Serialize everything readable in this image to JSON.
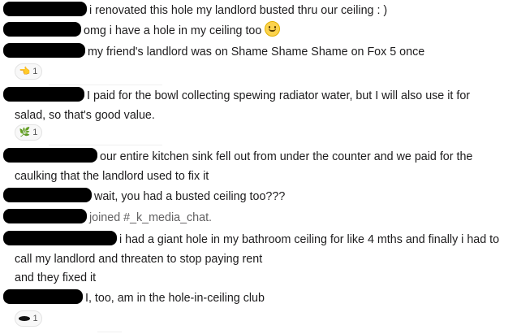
{
  "messages": [
    {
      "text": "i renovated this hole my landlord busted thru our ceiling : )"
    },
    {
      "text": "omg i have a hole in my ceiling too",
      "emoji": "smiley-face"
    },
    {
      "text": "my friend's landlord was on Shame Shame Shame on Fox 5 once"
    },
    {
      "line1": "I paid for the bowl collecting spewing radiator water, but I will also use it for",
      "line2": "salad, so that's good value."
    },
    {
      "line1": "our entire kitchen sink fell out from under the counter and we paid for the",
      "line2": "caulking that the landlord used to fix it"
    },
    {
      "text": "wait, you had a busted ceiling too???"
    },
    {
      "text": "joined #_k_media_chat."
    },
    {
      "line1": "i had a giant hole in my bathroom ceiling for like 4 mths and finally i had to",
      "line2": "call my landlord and threaten to stop paying rent"
    },
    {
      "text": "and they fixed it"
    },
    {
      "text": "I, too, am in the hole-in-ceiling club"
    }
  ],
  "reactions": [
    {
      "emoji": "👈",
      "icon": "pointing-hand-icon",
      "count": "1"
    },
    {
      "emoji": "🌿",
      "icon": "herb-icon",
      "count": "1"
    },
    {
      "emoji": "",
      "icon": "hole-icon",
      "count": "1"
    }
  ]
}
